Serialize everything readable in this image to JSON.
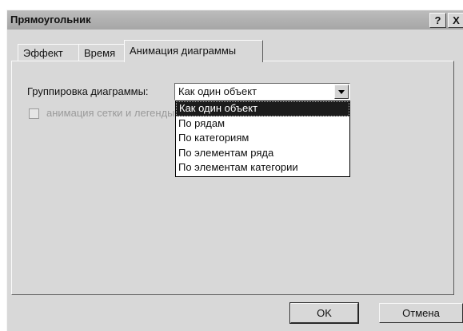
{
  "window": {
    "title": "Прямоугольник",
    "help_label": "?",
    "close_label": "X"
  },
  "tabs": [
    {
      "label": "Эффект",
      "active": false
    },
    {
      "label": "Время",
      "active": false
    },
    {
      "label": "Анимация диаграммы",
      "active": true
    }
  ],
  "grouping": {
    "label": "Группировка диаграммы:",
    "selected": "Как один объект",
    "options": [
      "Как один объект",
      "По рядам",
      "По категориям",
      "По элементам ряда",
      "По элементам категории"
    ]
  },
  "checkbox": {
    "label": "анимация сетки и легенды",
    "checked": false,
    "enabled": false
  },
  "buttons": {
    "ok": "OK",
    "cancel": "Отмена"
  },
  "colors": {
    "dialog_bg": "#d8d8d8",
    "selection_bg": "#1c1c1c",
    "disabled_text": "#9a9a9a"
  }
}
